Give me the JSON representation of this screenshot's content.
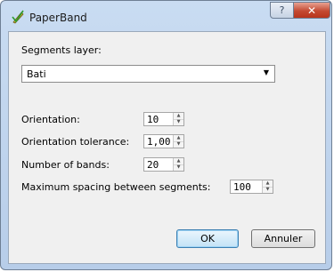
{
  "window": {
    "title": "PaperBand",
    "help_label": "?",
    "close_label": "✕"
  },
  "form": {
    "segments_layer_label": "Segments layer:",
    "segments_layer_value": "Bati",
    "orientation_label": "Orientation:",
    "orientation_value": "10",
    "orientation_tolerance_label": "Orientation tolerance:",
    "orientation_tolerance_value": "1,00",
    "number_of_bands_label": "Number of bands:",
    "number_of_bands_value": "20",
    "max_spacing_label": "Maximum spacing between segments:",
    "max_spacing_value": "100"
  },
  "buttons": {
    "ok_label": "OK",
    "cancel_label": "Annuler"
  },
  "icons": {
    "app": "paperband-pen-icon",
    "help": "help-icon",
    "close": "close-icon",
    "dropdown": "chevron-down-icon"
  }
}
